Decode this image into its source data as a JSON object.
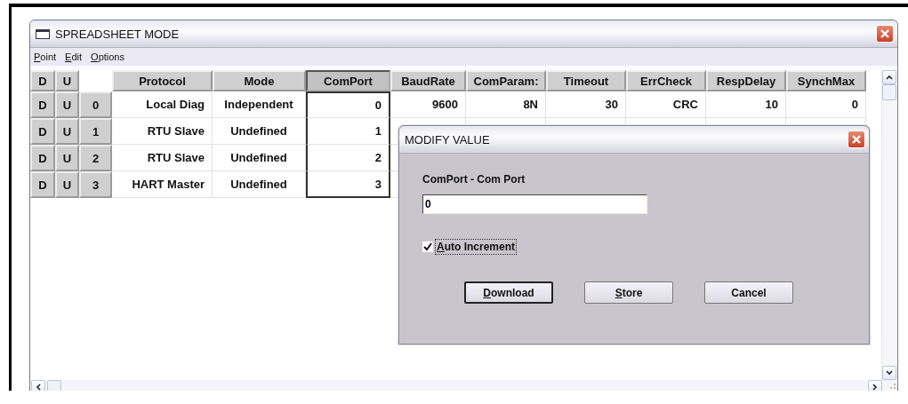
{
  "window": {
    "title": "SPREADSHEET MODE"
  },
  "menu": [
    {
      "label": "Point",
      "underline_first": true
    },
    {
      "label": "Edit",
      "underline_first": true
    },
    {
      "label": "Options",
      "underline_first": true
    }
  ],
  "table": {
    "corner_buttons": [
      "D",
      "U"
    ],
    "columns": [
      {
        "label": "Protocol",
        "selected": false
      },
      {
        "label": "Mode",
        "selected": false
      },
      {
        "label": "ComPort",
        "selected": true
      },
      {
        "label": "BaudRate",
        "selected": false
      },
      {
        "label": "ComParam:",
        "selected": false
      },
      {
        "label": "Timeout",
        "selected": false
      },
      {
        "label": "ErrCheck",
        "selected": false
      },
      {
        "label": "RespDelay",
        "selected": false
      },
      {
        "label": "SynchMax",
        "selected": false
      }
    ],
    "rows": [
      {
        "buttons": [
          "D",
          "U"
        ],
        "index": "0",
        "cells": [
          "Local Diag",
          "Independent",
          "0",
          "9600",
          "8N",
          "30",
          "CRC",
          "10",
          "0"
        ]
      },
      {
        "buttons": [
          "D",
          "U"
        ],
        "index": "1",
        "cells": [
          "RTU Slave",
          "Undefined",
          "1"
        ]
      },
      {
        "buttons": [
          "D",
          "U"
        ],
        "index": "2",
        "cells": [
          "RTU Slave",
          "Undefined",
          "2"
        ]
      },
      {
        "buttons": [
          "D",
          "U"
        ],
        "index": "3",
        "cells": [
          "HART Master",
          "Undefined",
          "3"
        ]
      }
    ]
  },
  "dialog": {
    "title": "MODIFY VALUE",
    "field_label": "ComPort - Com Port",
    "value": "0",
    "checkbox": {
      "label": "Auto Increment",
      "checked": true,
      "underline_first": true
    },
    "buttons": [
      {
        "label": "Download",
        "underline_first": true,
        "default": true
      },
      {
        "label": "Store",
        "underline_first": true,
        "default": false
      },
      {
        "label": "Cancel",
        "underline_first": false,
        "default": false
      }
    ]
  }
}
